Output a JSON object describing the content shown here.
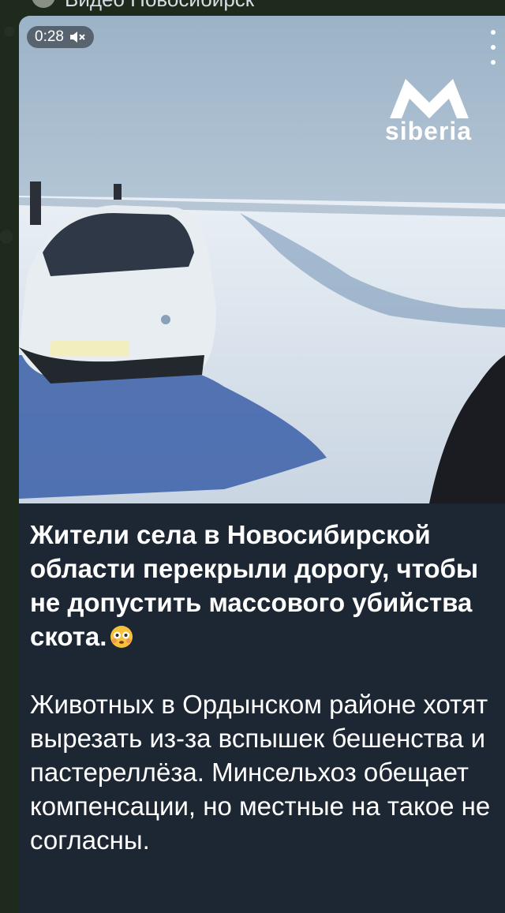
{
  "channel": {
    "name": "Видео Новосибирск"
  },
  "video": {
    "duration": "0:28",
    "muted": true,
    "watermark": {
      "text": "siberia",
      "logo_letter": "M"
    }
  },
  "post": {
    "headline": "Жители села в Новосибирской области перекрыли дорогу, чтобы не допустить массового убийства скота.",
    "headline_emoji": "flushed-face-emoji",
    "body": "Животных в Ордынском районе хотят вырезать из-за вспышек бешенства и пастереллёза. Минсельхоз обещает компенсации, но местные на такое не согласны."
  },
  "colors": {
    "bubble": "#1d2733",
    "background": "#1e2a1b",
    "text": "#ffffff"
  }
}
